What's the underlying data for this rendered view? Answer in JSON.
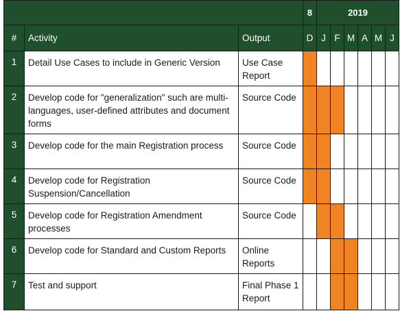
{
  "header": {
    "year_2018": "8",
    "year_2019": "2019",
    "col_num": "#",
    "col_activity": "Activity",
    "col_output": "Output",
    "months": [
      "D",
      "J",
      "F",
      "M",
      "A",
      "M",
      "J"
    ]
  },
  "rows": [
    {
      "num": "1",
      "activity": "Detail Use Cases to include in Generic Version",
      "output": "Use Case Report",
      "active": [
        true,
        false,
        false,
        false,
        false,
        false,
        false
      ]
    },
    {
      "num": "2",
      "activity": "Develop code for \"generalization\" such are multi-languages, user-defined attributes and document forms",
      "output": "Source Code",
      "active": [
        true,
        true,
        true,
        false,
        false,
        false,
        false
      ]
    },
    {
      "num": "3",
      "activity": "Develop code for the main Registration process",
      "output": "Source Code",
      "active": [
        true,
        true,
        false,
        false,
        false,
        false,
        false
      ]
    },
    {
      "num": "4",
      "activity": "Develop code for Registration Suspension/Cancellation",
      "output": "Source Code",
      "active": [
        true,
        true,
        false,
        false,
        false,
        false,
        false
      ]
    },
    {
      "num": "5",
      "activity": "Develop code for Registration Amendment processes",
      "output": "Source Code",
      "active": [
        false,
        true,
        true,
        false,
        false,
        false,
        false
      ]
    },
    {
      "num": "6",
      "activity": "Develop code for Standard and Custom Reports",
      "output": "Online Reports",
      "active": [
        false,
        false,
        true,
        true,
        false,
        false,
        false
      ]
    },
    {
      "num": "7",
      "activity": "Test and support",
      "output": "Final Phase 1 Report",
      "active": [
        false,
        false,
        true,
        true,
        false,
        false,
        false
      ]
    }
  ],
  "colors": {
    "header_bg": "#1f4f2c",
    "bar": "#f08422"
  }
}
